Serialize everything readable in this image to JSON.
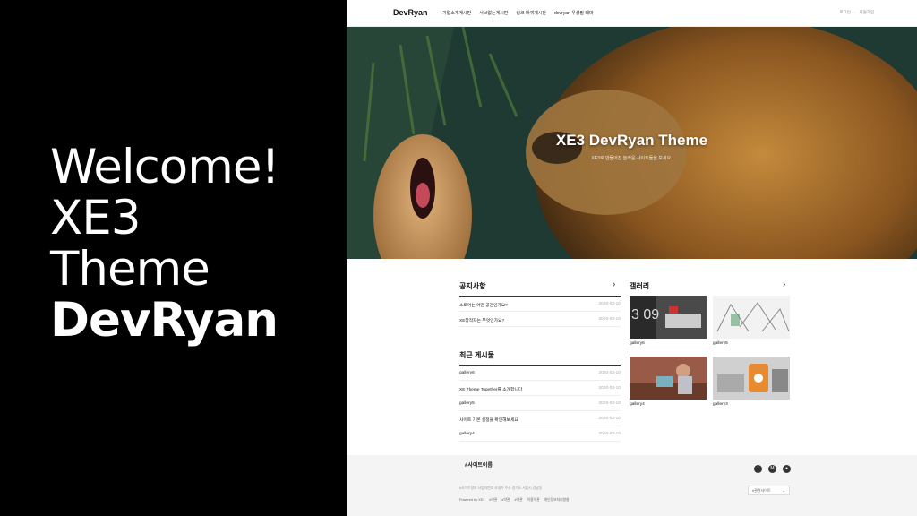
{
  "welcome": {
    "line1": "Welcome!",
    "line2": "XE3",
    "line3": "Theme",
    "line4": "DevRyan"
  },
  "nav": {
    "logo": "DevRyan",
    "menu": [
      "기업소개게시판",
      "서브없는게시판",
      "링크 바뀌게시판",
      "devryan 우셩필 테마"
    ],
    "login": "로그인",
    "signup": "회원가입"
  },
  "hero": {
    "title": "XE3 DevRyan Theme",
    "subtitle": "XE3로 만들어진 놀라운 사이트들을 보세요."
  },
  "notice": {
    "title": "공지사항",
    "arrow": "›",
    "items": [
      {
        "title": "스토어는 어떤 공간인가요?",
        "date": "2020-03-10"
      },
      {
        "title": "XE창작자는 무엇인가요?",
        "date": "2020-03-10"
      }
    ]
  },
  "recent": {
    "title": "최근 게시물",
    "items": [
      {
        "title": "gallery6",
        "date": "2020-03-10"
      },
      {
        "title": "XE Theme Together를 소개합니다",
        "date": "2020-03-10"
      },
      {
        "title": "gallery5",
        "date": "2020-03-10"
      },
      {
        "title": "사이트 기본 설정을 확인해보세요",
        "date": "2020-03-10"
      },
      {
        "title": "gallery4",
        "date": "2020-03-10"
      }
    ]
  },
  "gallery": {
    "title": "갤러리",
    "arrow": "›",
    "items": [
      {
        "caption": "gallery6"
      },
      {
        "caption": "gallery5"
      },
      {
        "caption": "gallery4"
      },
      {
        "caption": "gallery3"
      }
    ]
  },
  "footer": {
    "site": "#사이트이름",
    "address": "#사이트정보 사업자번호 사내가 주소 경기도 서울시 강남동",
    "powered": "Powered by XE3",
    "links": [
      "#약관",
      "#약관",
      "#약관",
      "이용약관",
      "개인정보처리방침"
    ],
    "select": "#관련사이트"
  },
  "colors": {
    "left_bg": "#000000",
    "accent": "#111111"
  },
  "icons": [
    "facebook-icon",
    "medium-icon",
    "github-icon",
    "chevron-right-icon"
  ]
}
